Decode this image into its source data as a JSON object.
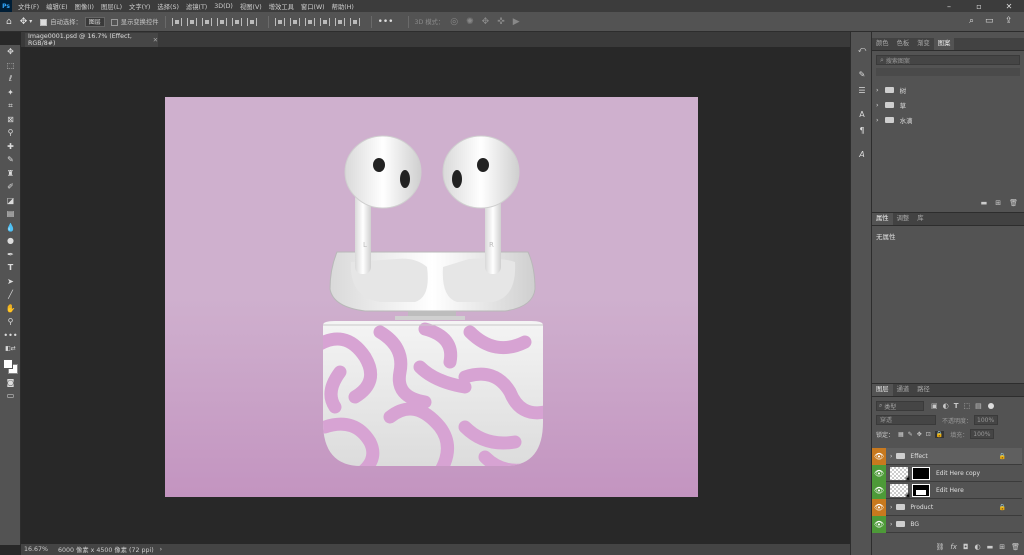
{
  "app": {
    "logo": "Ps"
  },
  "menu": [
    "文件(F)",
    "编辑(E)",
    "图像(I)",
    "图层(L)",
    "文字(Y)",
    "选择(S)",
    "滤镜(T)",
    "3D(D)",
    "视图(V)",
    "增效工具",
    "窗口(W)",
    "帮助(H)"
  ],
  "options": {
    "auto_select_label": "自动选择：",
    "auto_select_target": "图层",
    "show_transform_label": "显示变换控件",
    "mode_3d_label": "3D 模式："
  },
  "document": {
    "tab_title": "Image0001.psd @ 16.7% (Effect, RGB/8#)",
    "zoom": "16.67%",
    "size_info": "6000 像素 x 4500 像素 (72 ppi)"
  },
  "right_top_tabs": [
    "颜色",
    "色板",
    "渐变",
    "图案"
  ],
  "patterns": {
    "search_placeholder": "搜索图案",
    "groups": [
      "树",
      "草",
      "水滴"
    ]
  },
  "properties": {
    "tabs": [
      "属性",
      "调整",
      "库"
    ],
    "empty_text": "无属性"
  },
  "layers_panel": {
    "tabs": [
      "图层",
      "通道",
      "路径"
    ],
    "filter_kind": "类型",
    "blend_mode": "穿透",
    "opacity_label": "不透明度：",
    "opacity_value": "100%",
    "lock_label": "锁定：",
    "fill_label": "填充：",
    "fill_value": "100%",
    "layers": [
      {
        "name": "Effect",
        "type": "group",
        "color": "#c8791e",
        "locked": true
      },
      {
        "name": "Edit Here copy",
        "type": "smart",
        "color": "#4d9a38",
        "locked": false
      },
      {
        "name": "Edit Here",
        "type": "smart",
        "color": "#4d9a38",
        "locked": false
      },
      {
        "name": "Product",
        "type": "group",
        "color": "#c8791e",
        "locked": true
      },
      {
        "name": "BG",
        "type": "group",
        "color": "#4d9a38",
        "locked": false
      }
    ]
  },
  "earbud_letters": {
    "left": "L",
    "right": "R"
  },
  "colors": {
    "accent": "#31a8ff",
    "artboard_top": "#cfb0ce",
    "artboard_bottom": "#c394c0",
    "pattern_pink": "#d7a3d3"
  }
}
